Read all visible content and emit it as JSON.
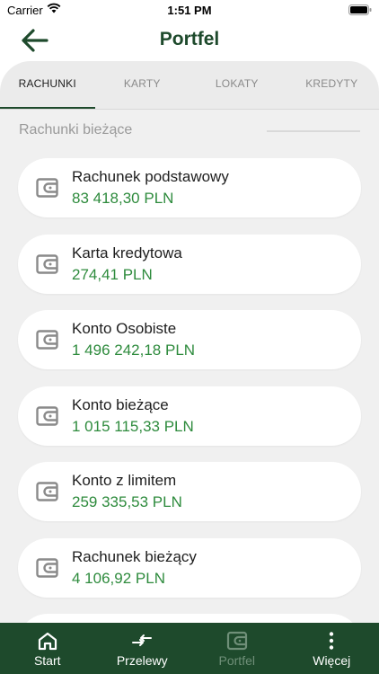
{
  "status_bar": {
    "carrier": "Carrier",
    "time": "1:51 PM"
  },
  "header": {
    "title": "Portfel",
    "back_icon": "arrow-left-icon"
  },
  "tabs": [
    {
      "label": "RACHUNKI",
      "active": true
    },
    {
      "label": "KARTY",
      "active": false
    },
    {
      "label": "LOKATY",
      "active": false
    },
    {
      "label": "KREDYTY",
      "active": false
    }
  ],
  "section": {
    "title": "Rachunki bieżące"
  },
  "accounts": [
    {
      "name": "Rachunek podstawowy",
      "amount": "83 418,30 PLN"
    },
    {
      "name": "Karta kredytowa",
      "amount": "274,41 PLN"
    },
    {
      "name": "Konto Osobiste",
      "amount": "1 496 242,18 PLN"
    },
    {
      "name": "Konto bieżące",
      "amount": "1 015 115,33 PLN"
    },
    {
      "name": "Konto z limitem",
      "amount": "259 335,53 PLN"
    },
    {
      "name": "Rachunek bieżący",
      "amount": "4 106,92 PLN"
    }
  ],
  "bottom_nav": [
    {
      "label": "Start",
      "icon": "home-icon",
      "active": false
    },
    {
      "label": "Przelewy",
      "icon": "transfer-icon",
      "active": false
    },
    {
      "label": "Portfel",
      "icon": "wallet-icon",
      "active": true
    },
    {
      "label": "Więcej",
      "icon": "more-vertical-icon",
      "active": false
    }
  ],
  "colors": {
    "brand": "#1e4a2c",
    "amount": "#2e8b3d",
    "background": "#f0f0f0"
  }
}
